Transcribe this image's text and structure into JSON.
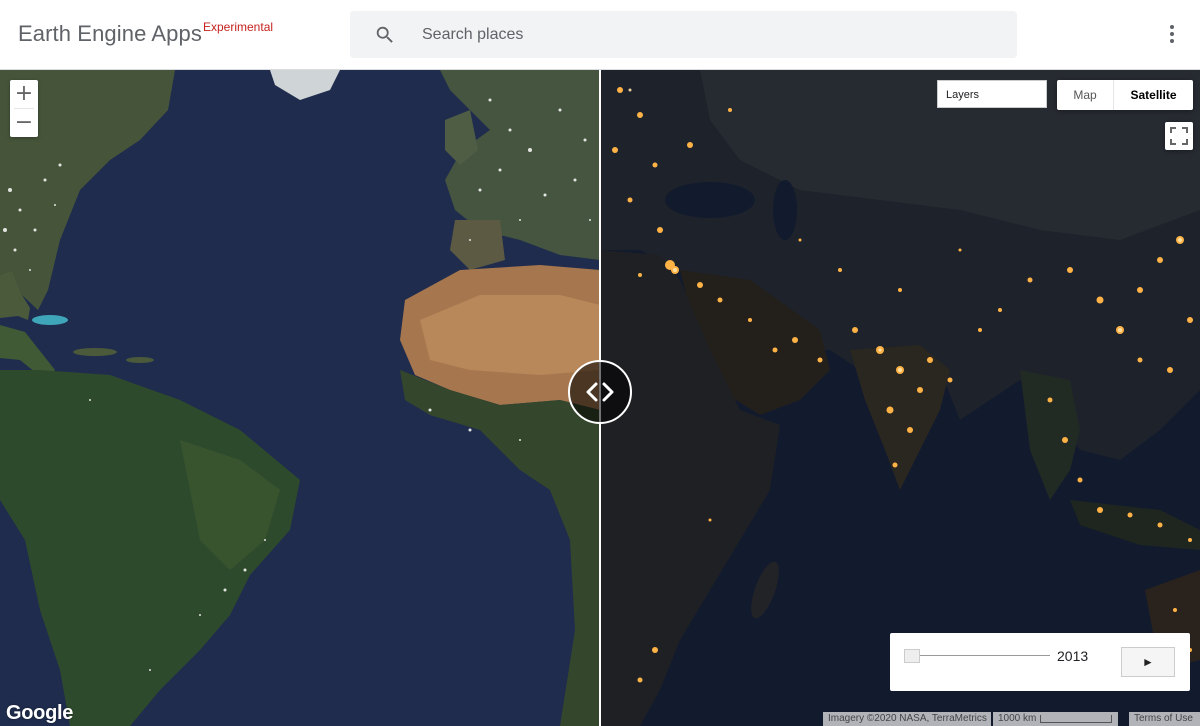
{
  "header": {
    "app_title": "Earth Engine Apps",
    "badge": "Experimental",
    "search": {
      "placeholder": "Search places",
      "value": ""
    },
    "menu_icon": "more-vert-icon"
  },
  "map": {
    "zoom_in_label": "+",
    "zoom_out_label": "−",
    "layers_label": "Layers",
    "map_type": {
      "map_label": "Map",
      "satellite_label": "Satellite",
      "selected": "Satellite"
    },
    "divider_icon": "split-arrows-icon",
    "fullscreen_icon": "fullscreen-icon"
  },
  "time_control": {
    "year": "2013",
    "slider_value": 0,
    "play_label": "►"
  },
  "footer": {
    "logo": "Google",
    "imagery": "Imagery ©2020 NASA, TerraMetrics",
    "scale": "1000 km",
    "terms": "Terms of Use"
  },
  "colors": {
    "ocean_left": "#1f2c4d",
    "ocean_right": "#121a2e",
    "city_lights": "#ffb347",
    "badge": "#c5221f"
  }
}
